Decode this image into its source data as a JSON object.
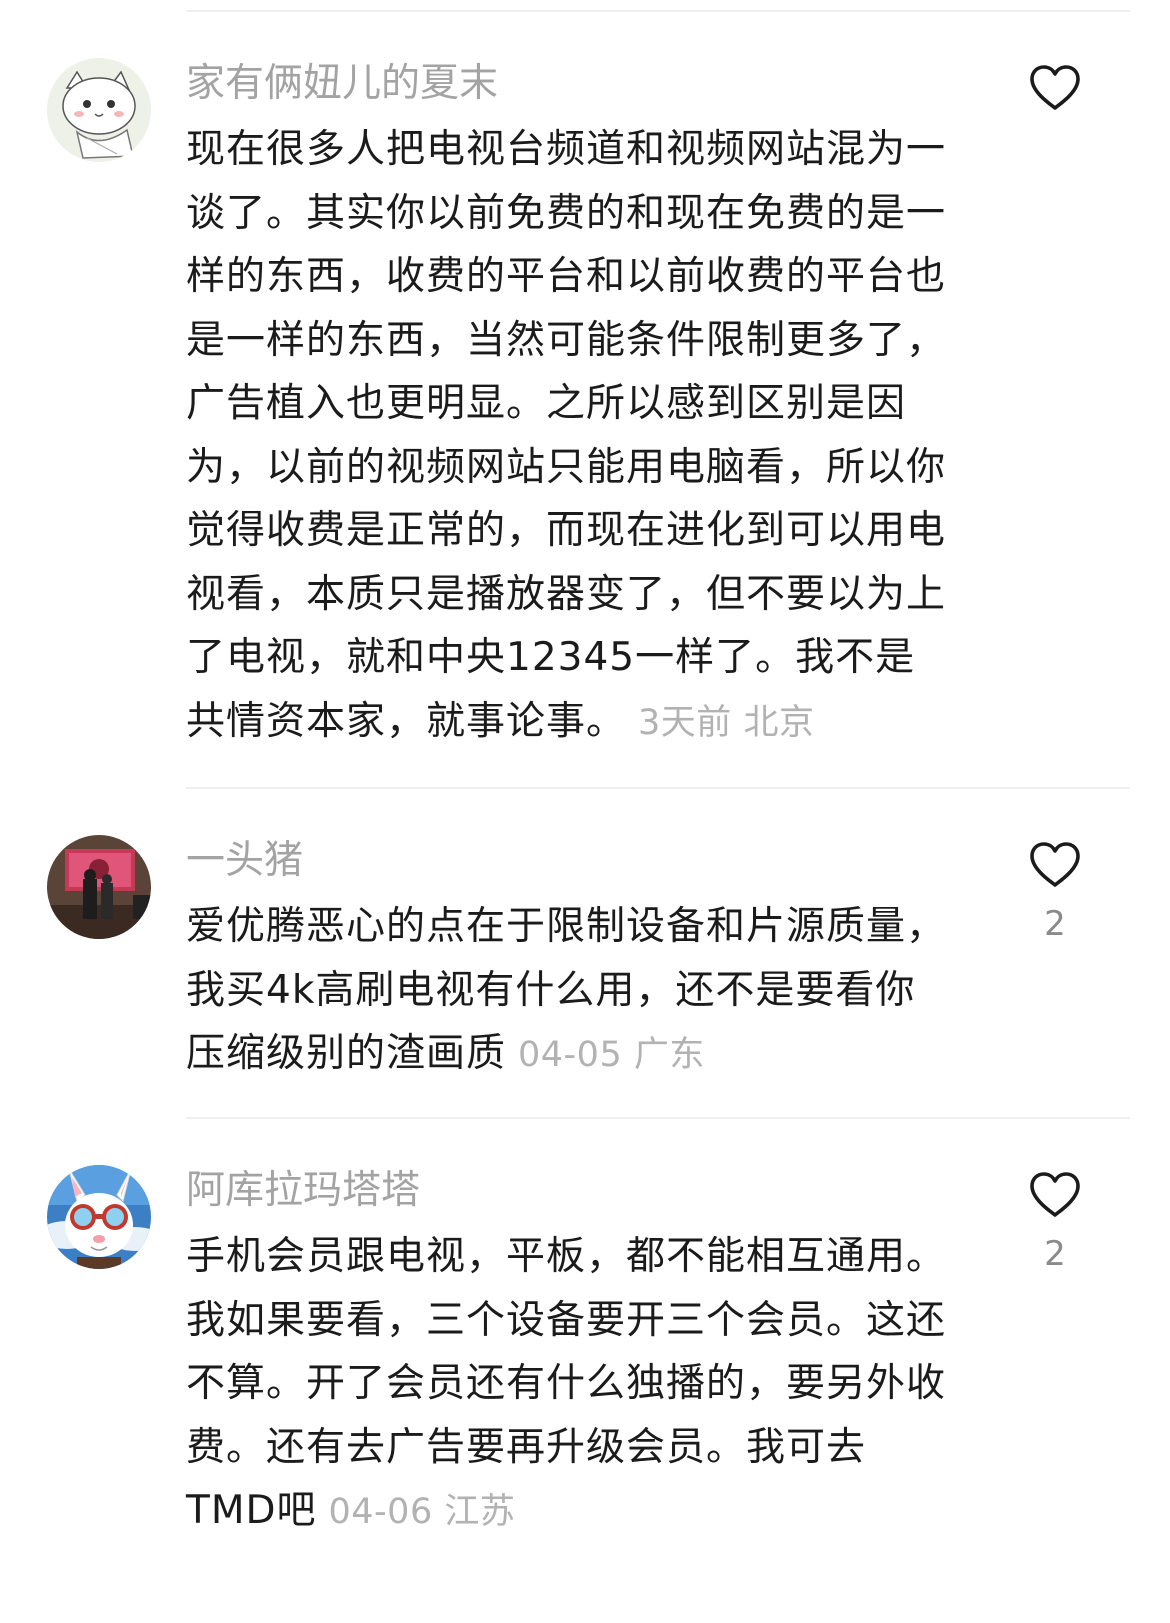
{
  "comments": [
    {
      "username": "家有俩妞儿的夏末",
      "lines": [
        "现在很多人把电视台频道和视频网站混为一",
        "谈了。其实你以前免费的和现在免费的是一",
        "样的东西，收费的平台和以前收费的平台也",
        "是一样的东西，当然可能条件限制更多了，",
        "广告植入也更明显。之所以感到区别是因",
        "为，以前的视频网站只能用电脑看，所以你",
        "觉得收费是正常的，而现在进化到可以用电",
        "视看，本质只是播放器变了，但不要以为上",
        "了电视，就和中央12345一样了。我不是",
        "共情资本家，就事论事。"
      ],
      "time": "3天前",
      "location": "北京",
      "likes": "",
      "like_icon": "heart-outline",
      "avatar_icon": "white-cat-avatar"
    },
    {
      "username": "一头猪",
      "lines": [
        "爱优腾恶心的点在于限制设备和片源质量，",
        "我买4k高刷电视有什么用，还不是要看你",
        "压缩级别的渣画质"
      ],
      "time": "04-05",
      "location": "广东",
      "likes": "2",
      "like_icon": "heart-outline",
      "avatar_icon": "concert-photo-avatar"
    },
    {
      "username": "阿库拉玛塔塔",
      "lines": [
        "手机会员跟电视，平板，都不能相互通用。",
        "我如果要看，三个设备要开三个会员。这还",
        "不算。开了会员还有什么独播的，要另外收",
        "费。还有去广告要再升级会员。我可去",
        "TMD吧"
      ],
      "time": "04-06",
      "location": "江苏",
      "likes": "2",
      "like_icon": "heart-outline",
      "avatar_icon": "bunny-goggles-avatar"
    }
  ],
  "colors": {
    "username": "#a3a3a3",
    "body_text": "#1b1b1b",
    "meta": "#b2b2b2",
    "divider": "#efefef",
    "heart_stroke": "#1b1b1b"
  }
}
